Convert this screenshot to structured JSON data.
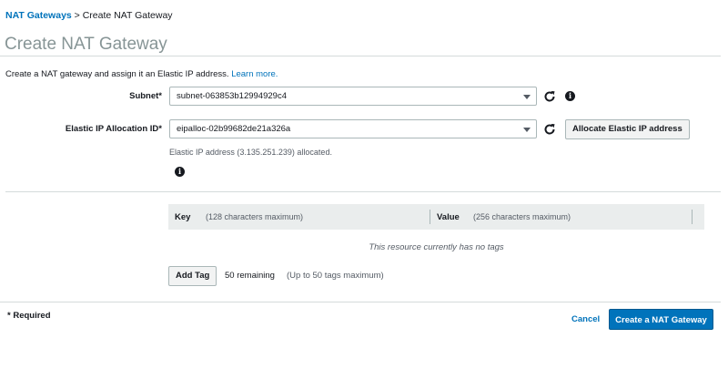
{
  "breadcrumb": {
    "parent": "NAT Gateways",
    "separator": " > ",
    "current": "Create NAT Gateway"
  },
  "page": {
    "title": "Create NAT Gateway",
    "intro": "Create a NAT gateway and assign it an Elastic IP address.",
    "learn_more": "Learn more."
  },
  "subnet": {
    "label": "Subnet*",
    "value": "subnet-063853b12994929c4"
  },
  "eip": {
    "label": "Elastic IP Allocation ID*",
    "value": "eipalloc-02b99682de21a326a",
    "allocate_button": "Allocate Elastic IP address",
    "hint": "Elastic IP address (3.135.251.239) allocated."
  },
  "tags": {
    "key_header": "Key",
    "key_hint": "(128 characters maximum)",
    "value_header": "Value",
    "value_hint": "(256 characters maximum)",
    "empty": "This resource currently has no tags",
    "add_button": "Add Tag",
    "remaining": "50 remaining",
    "remaining_hint": "(Up to 50 tags maximum)"
  },
  "footer": {
    "required": "* Required",
    "cancel": "Cancel",
    "submit": "Create a NAT Gateway"
  },
  "icons": {
    "refresh": "refresh-icon",
    "info": "info-icon"
  },
  "colors": {
    "link": "#0073bb",
    "primary": "#0073bb",
    "muted": "#879596"
  }
}
